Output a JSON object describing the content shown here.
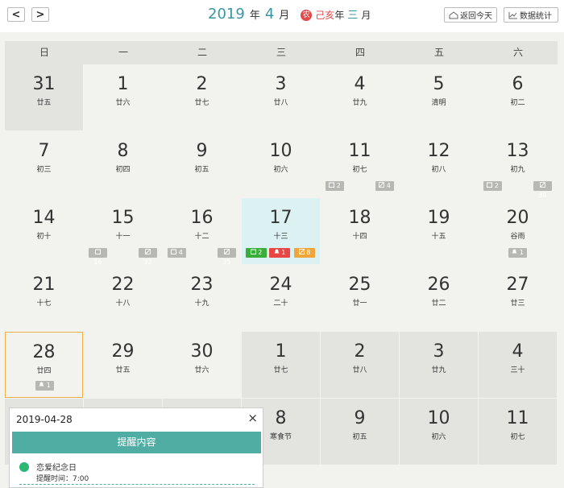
{
  "header": {
    "prev_label": "<",
    "next_label": ">",
    "year": "2019",
    "year_unit": "年",
    "month": "4",
    "month_unit": "月",
    "lunar_badge": "农",
    "ganzhi": "己亥",
    "ganzhi_unit": "年",
    "lunar_month": "三",
    "lunar_month_unit": "月",
    "today_button": "返回今天",
    "stats_button": "数据统计"
  },
  "weekdays": [
    "日",
    "一",
    "二",
    "三",
    "四",
    "五",
    "六"
  ],
  "weeks": [
    [
      {
        "day": "31",
        "lunar": "廿五",
        "other": true
      },
      {
        "day": "1",
        "lunar": "廿六"
      },
      {
        "day": "2",
        "lunar": "廿七"
      },
      {
        "day": "3",
        "lunar": "廿八"
      },
      {
        "day": "4",
        "lunar": "廿九"
      },
      {
        "day": "5",
        "lunar": "清明"
      },
      {
        "day": "6",
        "lunar": "初二"
      }
    ],
    [
      {
        "day": "7",
        "lunar": "初三"
      },
      {
        "day": "8",
        "lunar": "初四"
      },
      {
        "day": "9",
        "lunar": "初五"
      },
      {
        "day": "10",
        "lunar": "初六"
      },
      {
        "day": "11",
        "lunar": "初七",
        "badges": [
          {
            "type": "gray",
            "icon": "calendar-icon",
            "count": "2"
          },
          {
            "type": "gray",
            "icon": "note-icon",
            "count": "4"
          }
        ]
      },
      {
        "day": "12",
        "lunar": "初八"
      },
      {
        "day": "13",
        "lunar": "初九",
        "badges": [
          {
            "type": "gray",
            "icon": "calendar-icon",
            "count": "2"
          },
          {
            "type": "gray",
            "icon": "note-icon",
            "count": "38"
          }
        ]
      }
    ],
    [
      {
        "day": "14",
        "lunar": "初十"
      },
      {
        "day": "15",
        "lunar": "十一",
        "badges": [
          {
            "type": "gray",
            "icon": "calendar-icon",
            "count": "16"
          },
          {
            "type": "gray",
            "icon": "note-icon",
            "count": "32"
          }
        ]
      },
      {
        "day": "16",
        "lunar": "十二",
        "badges": [
          {
            "type": "gray",
            "icon": "calendar-icon",
            "count": "4"
          },
          {
            "type": "gray",
            "icon": "note-icon",
            "count": "35"
          }
        ]
      },
      {
        "day": "17",
        "lunar": "十三",
        "today": true,
        "badges": [
          {
            "type": "green",
            "icon": "calendar-icon",
            "count": "2"
          },
          {
            "type": "red",
            "icon": "bell-icon",
            "count": "1"
          },
          {
            "type": "orange",
            "icon": "note-icon",
            "count": "8"
          }
        ]
      },
      {
        "day": "18",
        "lunar": "十四"
      },
      {
        "day": "19",
        "lunar": "十五"
      },
      {
        "day": "20",
        "lunar": "谷雨",
        "badges": [
          {
            "type": "gray",
            "icon": "bell-icon",
            "count": "1"
          }
        ]
      }
    ],
    [
      {
        "day": "21",
        "lunar": "十七"
      },
      {
        "day": "22",
        "lunar": "十八"
      },
      {
        "day": "23",
        "lunar": "十九"
      },
      {
        "day": "24",
        "lunar": "二十"
      },
      {
        "day": "25",
        "lunar": "廿一"
      },
      {
        "day": "26",
        "lunar": "廿二"
      },
      {
        "day": "27",
        "lunar": "廿三"
      }
    ],
    [
      {
        "day": "28",
        "lunar": "廿四",
        "selected": true,
        "badges": [
          {
            "type": "gray",
            "icon": "bell-icon",
            "count": "1"
          }
        ]
      },
      {
        "day": "29",
        "lunar": "廿五"
      },
      {
        "day": "30",
        "lunar": "廿六"
      },
      {
        "day": "1",
        "lunar": "廿七",
        "other": true
      },
      {
        "day": "2",
        "lunar": "廿八",
        "other": true
      },
      {
        "day": "3",
        "lunar": "廿九",
        "other": true
      },
      {
        "day": "4",
        "lunar": "三十",
        "other": true
      }
    ],
    [
      {
        "day": "",
        "lunar": "",
        "other": true
      },
      {
        "day": "",
        "lunar": "",
        "other": true
      },
      {
        "day": "",
        "lunar": "",
        "other": true
      },
      {
        "day": "8",
        "lunar": "寒食节",
        "other": true
      },
      {
        "day": "9",
        "lunar": "初五",
        "other": true
      },
      {
        "day": "10",
        "lunar": "初六",
        "other": true
      },
      {
        "day": "11",
        "lunar": "初七",
        "other": true
      }
    ]
  ],
  "popup": {
    "date": "2019-04-28",
    "close": "×",
    "title": "提醒内容",
    "reminder_name": "恋爱纪念日",
    "reminder_time": "提醒时间：7:00"
  },
  "colors": {
    "accent": "#3a95a2",
    "today_bg": "#dcf2f2",
    "selected_border": "#f0b04a",
    "popup_header": "#4fada3",
    "reminder_dot": "#2bb673",
    "lunar_red": "#e04a4a"
  }
}
